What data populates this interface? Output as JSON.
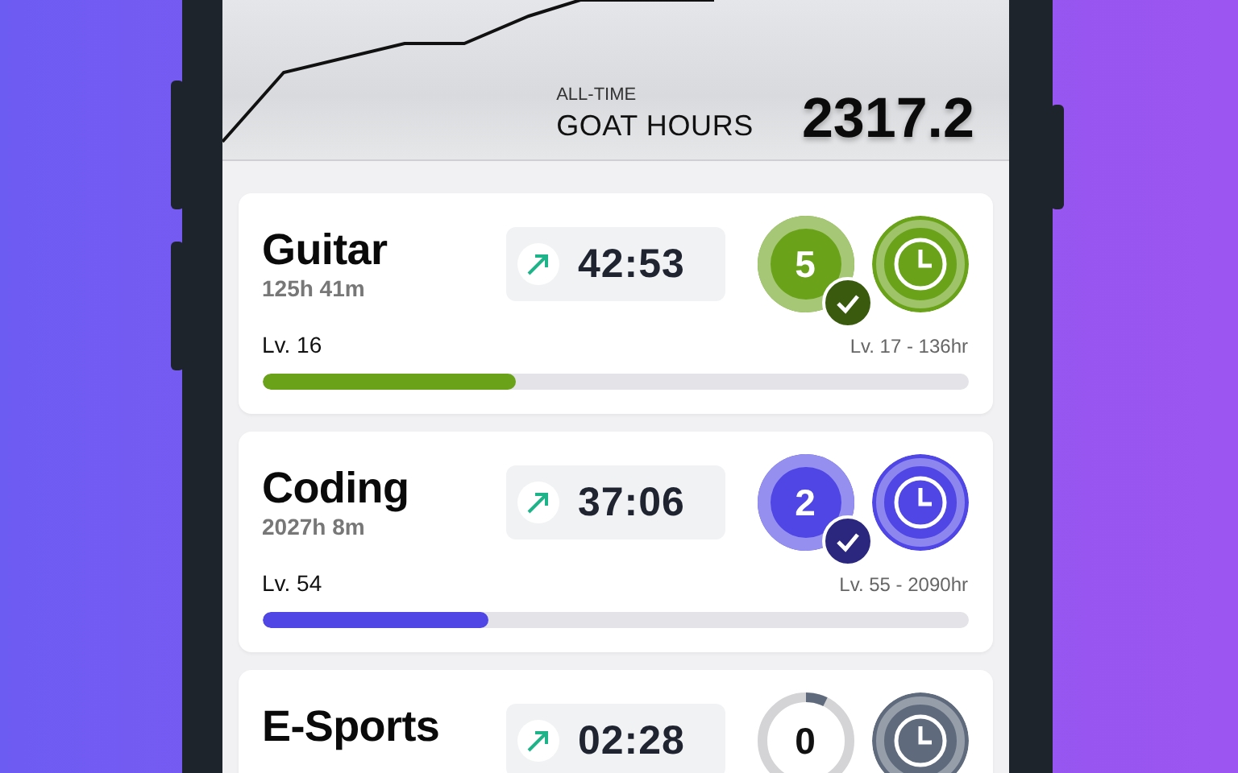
{
  "header": {
    "caption": "ALL-TIME",
    "label": "GOAT HOURS",
    "total": "2317.2"
  },
  "activities": [
    {
      "name": "Guitar",
      "total_time": "125h 41m",
      "timer": "42:53",
      "count": "5",
      "completed": true,
      "color": "#6aa31a",
      "level_label": "Lv. 16",
      "next_level": "Lv. 17 - 136hr",
      "level": 0.36
    },
    {
      "name": "Coding",
      "total_time": "2027h 8m",
      "timer": "37:06",
      "count": "2",
      "completed": true,
      "color": "#4f46e5",
      "level_label": "Lv. 54",
      "next_level": "Lv. 55 - 2090hr",
      "level": 0.32
    },
    {
      "name": "E-Sports",
      "timer": "02:28",
      "count": "0",
      "completed": false,
      "color": "#5f6b7c"
    }
  ]
}
